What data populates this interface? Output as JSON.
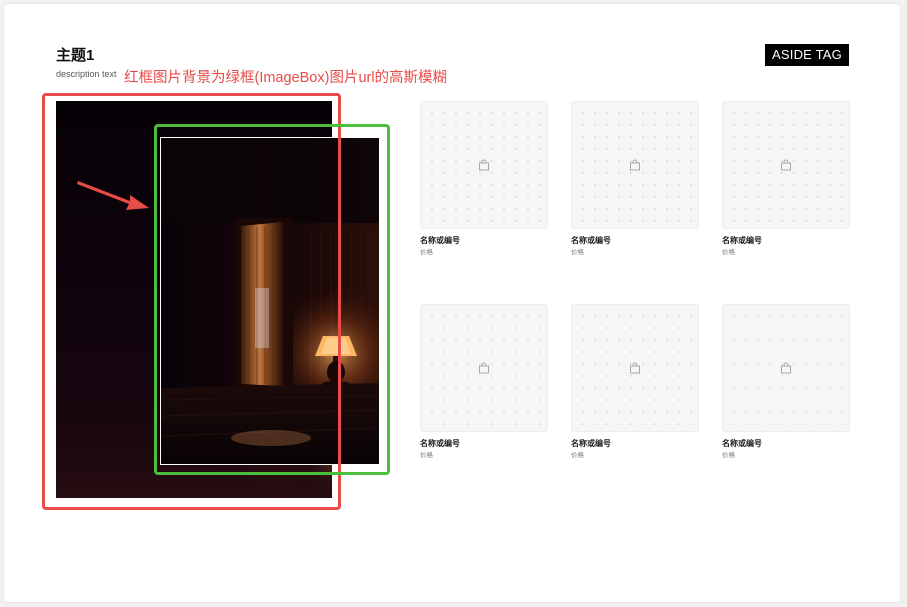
{
  "header": {
    "title": "主题1",
    "description": "description text",
    "aside_tag": "ASIDE TAG"
  },
  "annotation": {
    "text": "红框图片背景为绿框(ImageBox)图片url的高斯模糊",
    "red_frame_color": "#e84c49",
    "green_frame_color": "#4cbf3a"
  },
  "icons": {
    "product_placeholder": "shopping-bag-icon",
    "pointer": "arrow-icon"
  },
  "products": [
    {
      "name": "名称或编号",
      "price": "价格"
    },
    {
      "name": "名称或编号",
      "price": "价格"
    },
    {
      "name": "名称或编号",
      "price": "价格"
    },
    {
      "name": "名称或编号",
      "price": "价格"
    },
    {
      "name": "名称或编号",
      "price": "价格"
    },
    {
      "name": "名称或编号",
      "price": "价格"
    }
  ]
}
